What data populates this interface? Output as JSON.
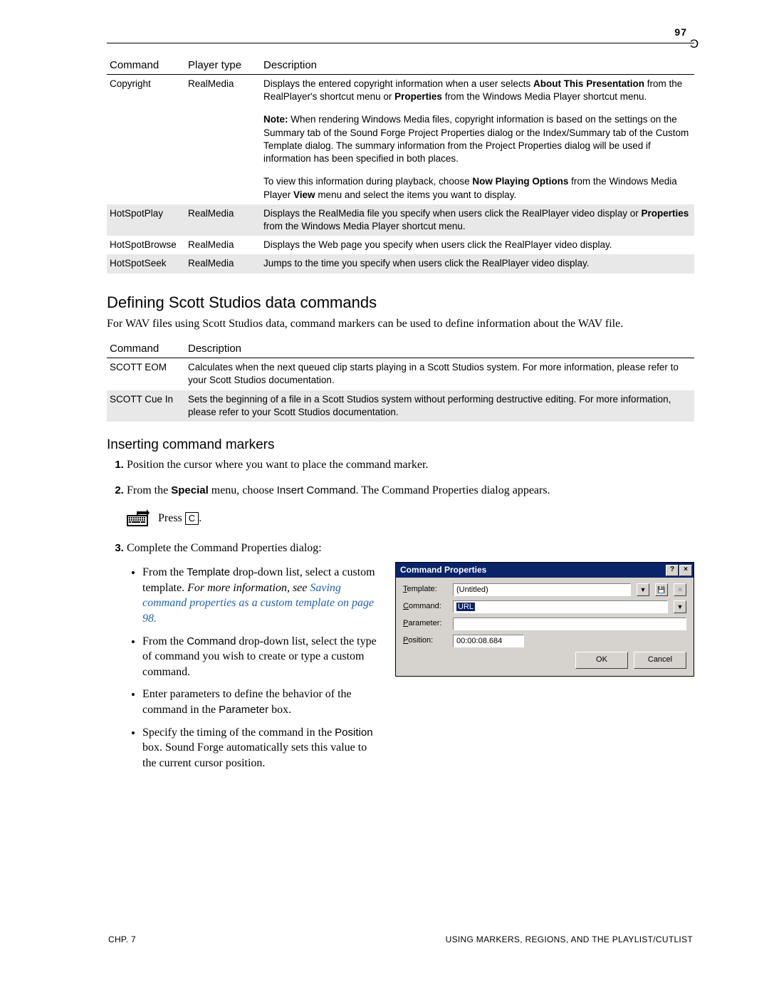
{
  "page_number": "97",
  "table1": {
    "headers": [
      "Command",
      "Player type",
      "Description"
    ],
    "rows": [
      {
        "command": "Copyright",
        "player": "RealMedia",
        "desc_parts": {
          "p1a": "Displays the entered copyright information when a user selects ",
          "p1b": "About This Presentation",
          "p1c": " from the RealPlayer's shortcut menu or ",
          "p1d": "Properties",
          "p1e": " from the Windows Media Player shortcut menu.",
          "p2a": "Note:",
          "p2b": " When rendering Windows Media files, copyright information is based on the settings on the Summary tab of the Sound Forge Project Properties dialog or the Index/Summary tab of the Custom Template dialog. The summary information from the Project Properties dialog will be used if information has been specified in both places.",
          "p3a": "To view this information during playback, choose ",
          "p3b": "Now Playing Options",
          "p3c": " from the Windows Media Player ",
          "p3d": "View",
          "p3e": " menu and select the items you want to display."
        }
      },
      {
        "command": "HotSpotPlay",
        "player": "RealMedia",
        "desc_parts": {
          "a": "Displays the RealMedia file you specify when users click the RealPlayer video display or ",
          "b": "Properties",
          "c": " from the Windows Media Player shortcut menu."
        }
      },
      {
        "command": "HotSpotBrowse",
        "player": "RealMedia",
        "desc": "Displays the Web page you specify when users click the RealPlayer video display."
      },
      {
        "command": "HotSpotSeek",
        "player": "RealMedia",
        "desc": "Jumps to the time you specify when users click the RealPlayer video display."
      }
    ]
  },
  "section1_title": "Defining Scott Studios data commands",
  "section1_body": "For WAV files using Scott Studios data, command markers can be used to define information about the WAV file.",
  "table2": {
    "headers": [
      "Command",
      "Description"
    ],
    "rows": [
      {
        "command": "SCOTT EOM",
        "desc": "Calculates when the next queued clip starts playing in a Scott Studios system. For more information, please refer to your Scott Studios documentation."
      },
      {
        "command": "SCOTT Cue In",
        "desc": "Sets the beginning of a file in a Scott Studios system without performing destructive editing. For more information, please refer to your Scott Studios documentation."
      }
    ]
  },
  "section2_title": "Inserting command markers",
  "steps": {
    "s1": "Position the cursor where you want to place the command marker.",
    "s2a": "From the ",
    "s2b": "Special",
    "s2c": " menu, choose ",
    "s2d": "Insert Command",
    "s2e": ". The Command Properties dialog appears.",
    "tip_a": "Press ",
    "tip_key": "C",
    "tip_b": ".",
    "s3": "Complete the Command Properties dialog:",
    "b1a": "From the ",
    "b1b": "Template",
    "b1c": " drop-down list, select a custom template. ",
    "b1d": "For more information, see ",
    "b1e": "Saving command properties as a custom template",
    "b1f": " on page 98.",
    "b2a": "From the ",
    "b2b": "Command",
    "b2c": " drop-down list, select the type of command you wish to create or type a custom command.",
    "b3a": "Enter parameters to define the behavior of the command in the ",
    "b3b": "Parameter",
    "b3c": " box.",
    "b4a": "Specify the timing of the command in the ",
    "b4b": "Position",
    "b4c": " box. Sound Forge automatically sets this value to the current cursor position."
  },
  "dialog": {
    "title": "Command Properties",
    "labels": {
      "template": "emplate:",
      "command": "ommand:",
      "parameter": "arameter:",
      "position": "osition:"
    },
    "accel": {
      "template": "T",
      "command": "C",
      "parameter": "P",
      "position": "P"
    },
    "template_value": "(Untitled)",
    "command_value": "URL",
    "parameter_value": "",
    "position_value": "00:00:08.684",
    "ok": "OK",
    "cancel": "Cancel"
  },
  "footer_left": "CHP. 7",
  "footer_right": "USING MARKERS, REGIONS, AND THE PLAYLIST/CUTLIST"
}
